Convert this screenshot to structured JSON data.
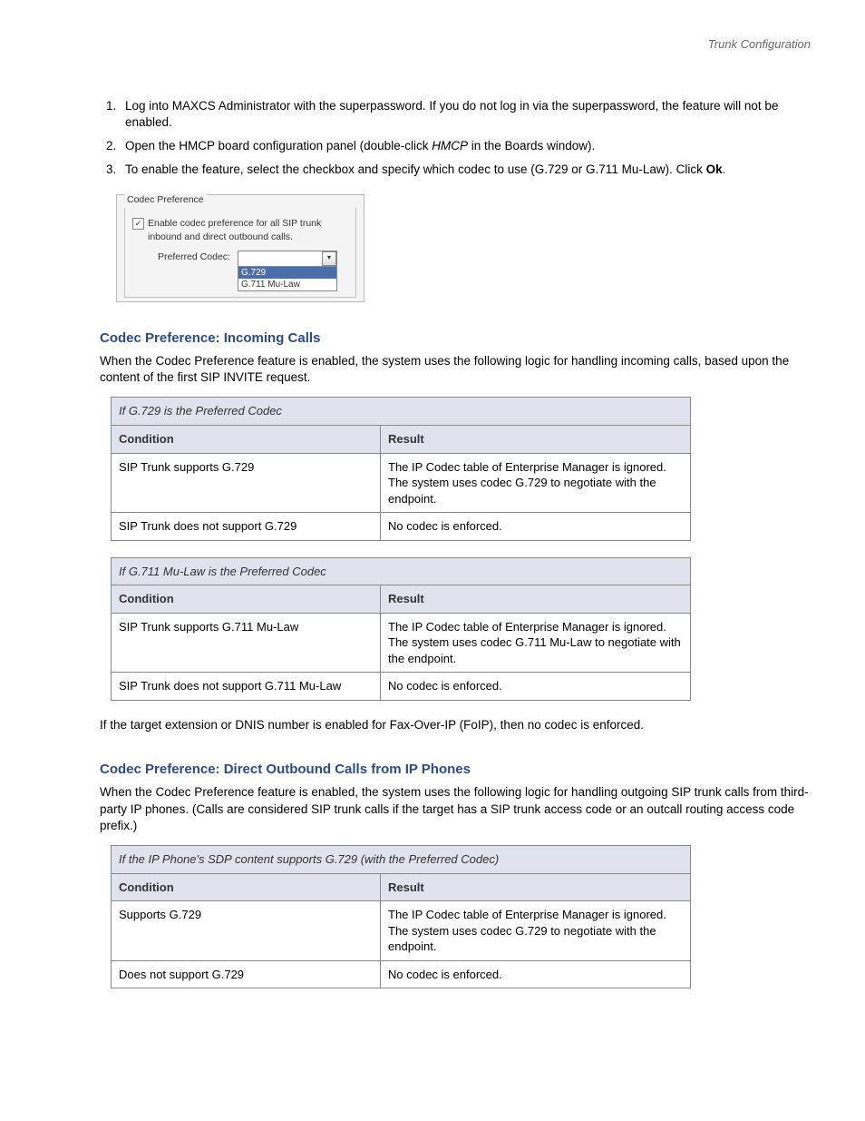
{
  "header": "Trunk Configuration",
  "steps": {
    "s1": "Log into MAXCS Administrator with the superpassword. If you do not log in via the superpassword, the feature will not be enabled.",
    "s2a": "Open the HMCP board configuration panel (double-click ",
    "s2b": "HMCP",
    "s2c": " in the Boards window).",
    "s3a": "To enable the feature, select the checkbox and specify which codec to use (G.729 or G.711 Mu-Law). Click ",
    "s3b": "Ok",
    "s3c": "."
  },
  "ui": {
    "groupLabel": "Codec Preference",
    "enableText": "Enable codec preference for all SIP trunk inbound and direct outbound calls.",
    "prefLabel": "Preferred Codec:",
    "opt1": "G.729",
    "opt2": "G.711 Mu-Law"
  },
  "sec1": {
    "title": "Codec Preference: Incoming Calls",
    "intro": "When the Codec Preference feature is enabled, the system uses the following logic for handling incoming calls, based upon the content of the first SIP INVITE request."
  },
  "tableA": {
    "caption": "If G.729 is the Preferred Codec",
    "h1": "Condition",
    "h2": "Result",
    "r1c1": "SIP Trunk supports G.729",
    "r1c2": "The IP Codec table of Enterprise Manager is ignored. The system uses codec G.729 to negotiate with the endpoint.",
    "r2c1": "SIP Trunk does not support G.729",
    "r2c2": "No codec is enforced."
  },
  "tableB": {
    "caption": "If G.711 Mu-Law is the Preferred Codec",
    "h1": "Condition",
    "h2": "Result",
    "r1c1": "SIP Trunk supports G.711 Mu-Law",
    "r1c2": "The IP Codec table of Enterprise Manager is ignored. The system uses codec G.711 Mu-Law to negotiate with the endpoint.",
    "r2c1": "SIP Trunk does not support G.711 Mu-Law",
    "r2c2": "No codec is enforced."
  },
  "note": "If the target extension or DNIS number is enabled for Fax-Over-IP (FoIP), then no codec is enforced.",
  "sec2": {
    "title": "Codec Preference: Direct Outbound Calls from IP Phones",
    "intro": "When the Codec Preference feature is enabled, the system uses the following logic for handling outgoing SIP trunk calls from third-party IP phones. (Calls are considered SIP trunk calls if the target has a SIP trunk access code or an outcall routing access code prefix.)"
  },
  "tableC": {
    "caption": "If the IP Phone's SDP content supports G.729 (with the Preferred Codec)",
    "h1": "Condition",
    "h2": "Result",
    "r1c1": "Supports G.729",
    "r1c2": "The IP Codec table of Enterprise Manager is ignored. The system uses codec G.729 to negotiate with the endpoint.",
    "r2c1": "Does not support G.729",
    "r2c2": "No codec is enforced."
  }
}
